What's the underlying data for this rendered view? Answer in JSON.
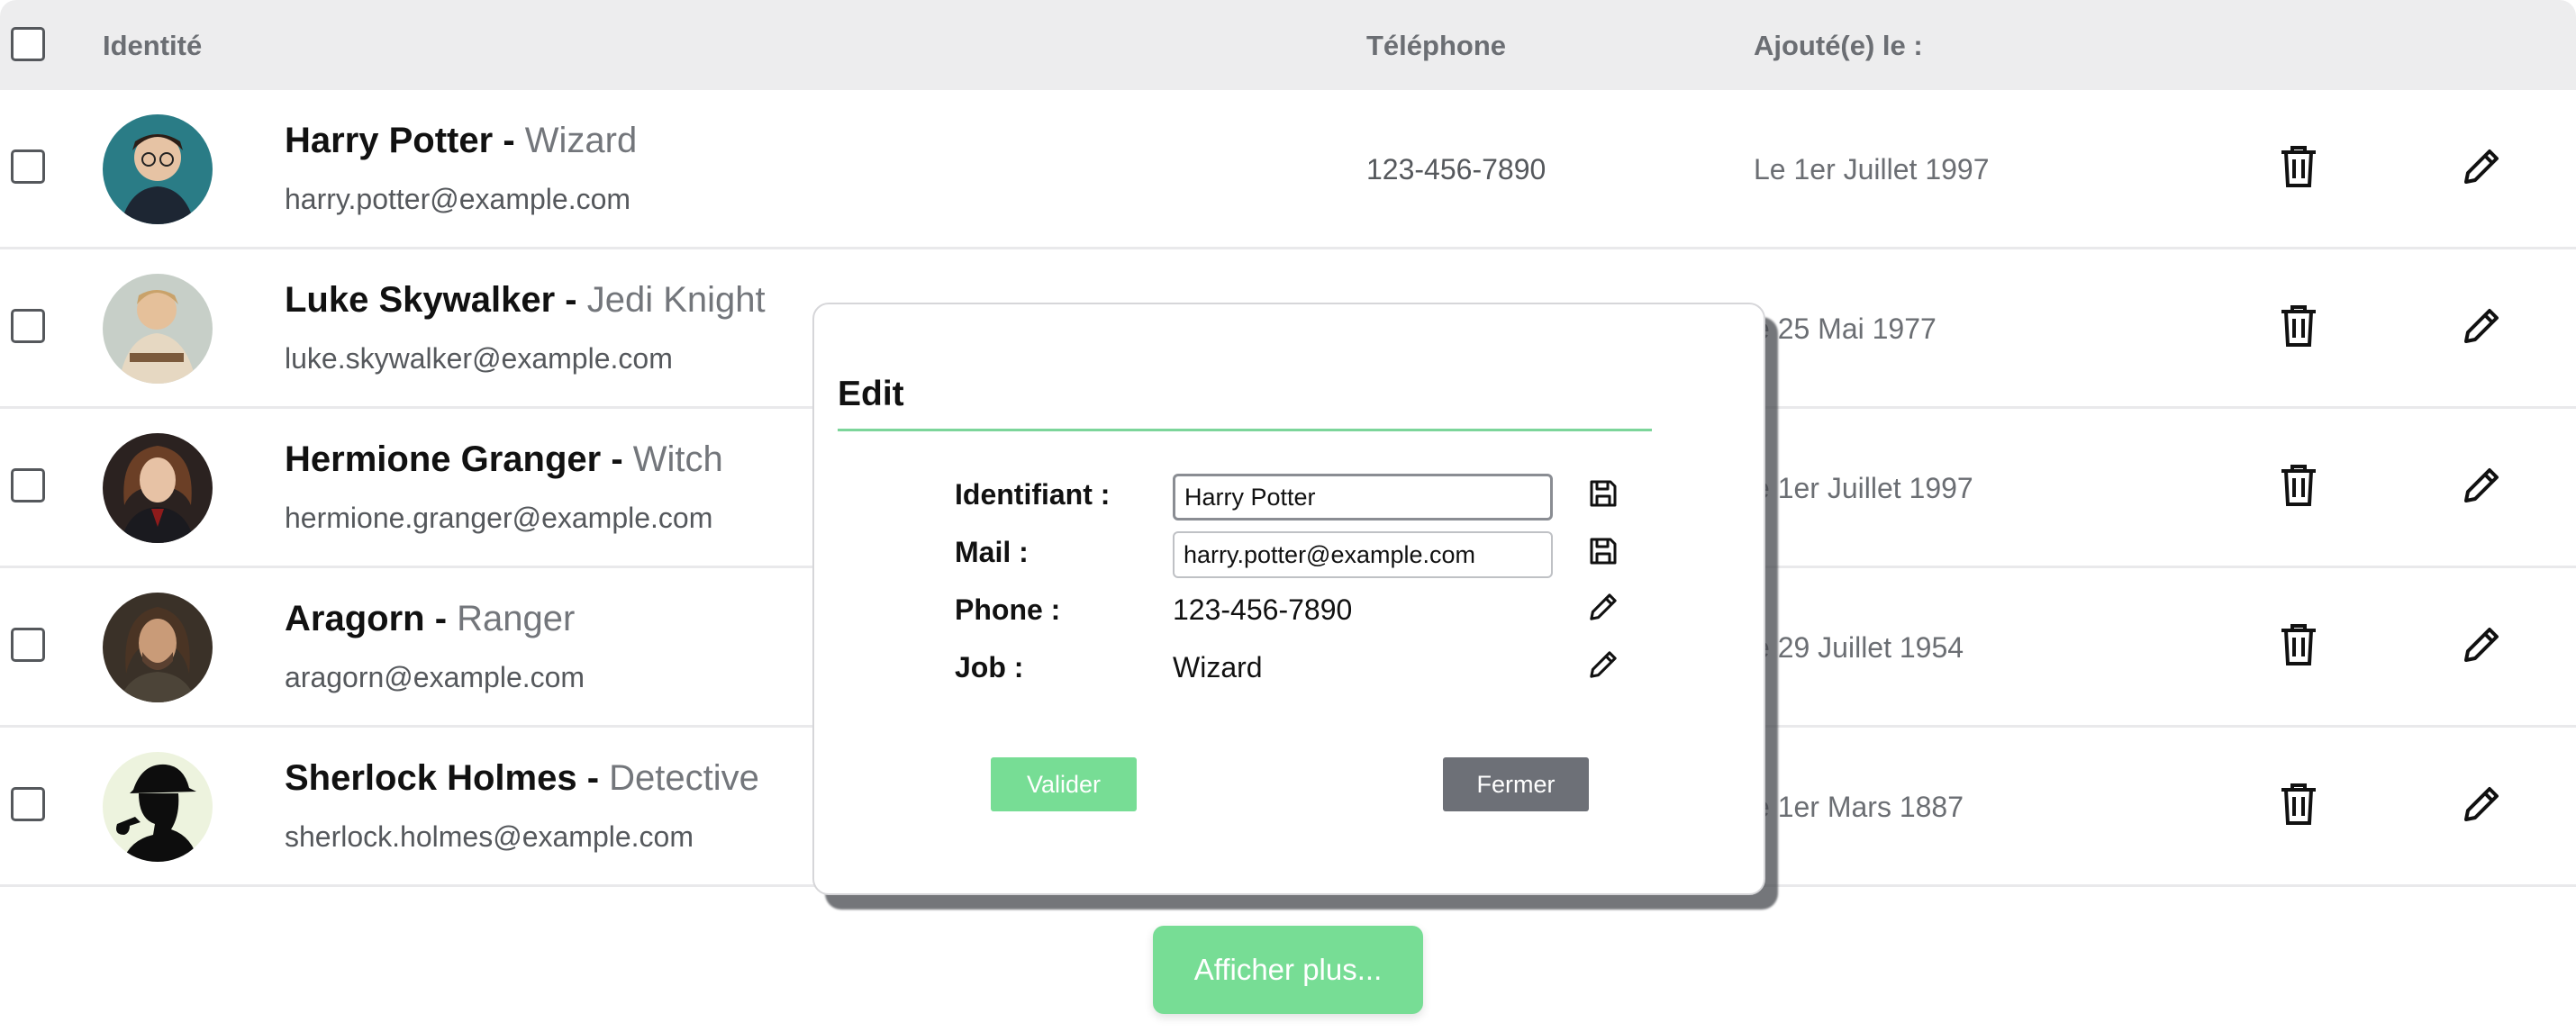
{
  "header": {
    "identity": "Identité",
    "phone": "Téléphone",
    "added": "Ajouté(e) le :"
  },
  "rows": [
    {
      "name": "Harry Potter",
      "separator": " - ",
      "job": "Wizard",
      "email": "harry.potter@example.com",
      "phone": "123-456-7890",
      "date": "Le 1er Juillet 1997",
      "avatar_icon": "avatar-harry"
    },
    {
      "name": "Luke Skywalker",
      "separator": " - ",
      "job": "Jedi Knight",
      "email": "luke.skywalker@example.com",
      "phone": "",
      "date": "e 25 Mai 1977",
      "avatar_icon": "avatar-luke"
    },
    {
      "name": "Hermione Granger",
      "separator": " - ",
      "job": "Witch",
      "email": "hermione.granger@example.com",
      "phone": "",
      "date": "e 1er Juillet 1997",
      "avatar_icon": "avatar-hermione"
    },
    {
      "name": "Aragorn",
      "separator": " - ",
      "job": "Ranger",
      "email": "aragorn@example.com",
      "phone": "",
      "date": "e 29 Juillet 1954",
      "avatar_icon": "avatar-aragorn"
    },
    {
      "name": "Sherlock Holmes",
      "separator": " - ",
      "job": "Detective",
      "email": "sherlock.holmes@example.com",
      "phone": "",
      "date": "e 1er Mars 1887",
      "avatar_icon": "avatar-sherlock"
    }
  ],
  "row_actions": {
    "delete_icon": "trash-icon",
    "edit_icon": "pencil-icon"
  },
  "modal": {
    "title": "Edit",
    "fields": [
      {
        "label": "Identifiant :",
        "value": "Harry Potter",
        "mode": "input",
        "action_icon": "save-icon"
      },
      {
        "label": "Mail :",
        "value": "harry.potter@example.com",
        "mode": "input",
        "action_icon": "save-icon"
      },
      {
        "label": "Phone :",
        "value": "123-456-7890",
        "mode": "text",
        "action_icon": "pencil-icon"
      },
      {
        "label": "Job :",
        "value": "Wizard",
        "mode": "text",
        "action_icon": "pencil-icon"
      }
    ],
    "validate_label": "Valider",
    "close_label": "Fermer"
  },
  "show_more_label": "Afficher plus...",
  "colors": {
    "accent_green": "#77dd95",
    "header_bg": "#ededee",
    "close_button": "#6d7077",
    "divider": "#7cd59a"
  }
}
